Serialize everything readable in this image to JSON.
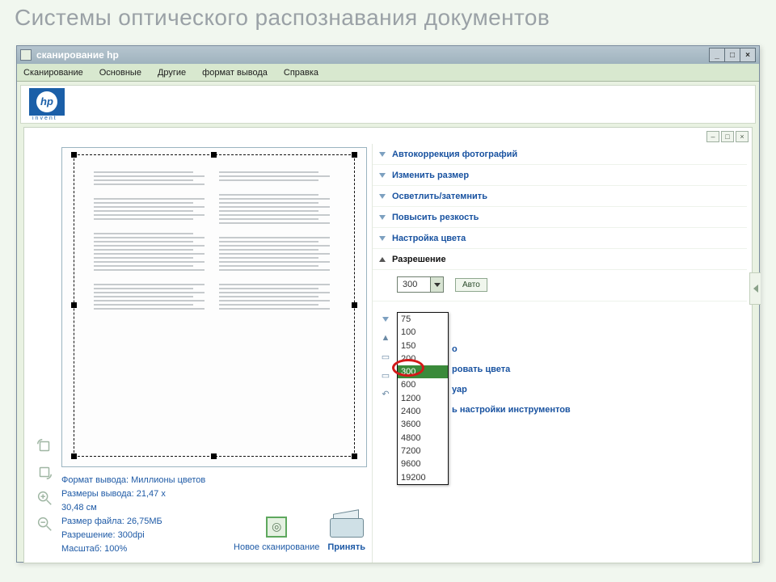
{
  "slide_title": "Системы оптического распознавания документов",
  "window": {
    "title": "сканирование hp",
    "min": "_",
    "max": "□",
    "close": "×"
  },
  "menu": {
    "scan": "Сканирование",
    "main": "Основные",
    "other": "Другие",
    "format": "формат вывода",
    "help": "Справка"
  },
  "logo": {
    "text": "hp",
    "sub": "invent"
  },
  "pane_tools": {
    "min": "–",
    "restore": "□",
    "close": "×"
  },
  "info": {
    "line1": "Формат вывода: Миллионы цветов",
    "line2": "Размеры вывода: 21,47 x",
    "line3": "30,48 см",
    "line4": "Размер файла: 26,75МБ",
    "line5": "Разрешение:  300dpi",
    "line6": "Масштаб: 100%",
    "new_scan": "Новое сканирование",
    "accept": "Принять"
  },
  "accordion": {
    "autocorrect": "Автокоррекция фотографий",
    "resize": "Изменить размер",
    "lighten": "Осветлить/затемнить",
    "sharpen": "Повысить резкость",
    "color": "Настройка цвета",
    "resolution": "Разрешение"
  },
  "resolution": {
    "value": "300",
    "auto": "Авто",
    "options": [
      "75",
      "100",
      "150",
      "200",
      "300",
      "600",
      "1200",
      "2400",
      "3600",
      "4800",
      "7200",
      "9600",
      "19200"
    ],
    "selected": "300"
  },
  "hidden_items": {
    "a": "о",
    "b": "ровать цвета",
    "c": "уар",
    "d": "ь настройки инструментов"
  }
}
